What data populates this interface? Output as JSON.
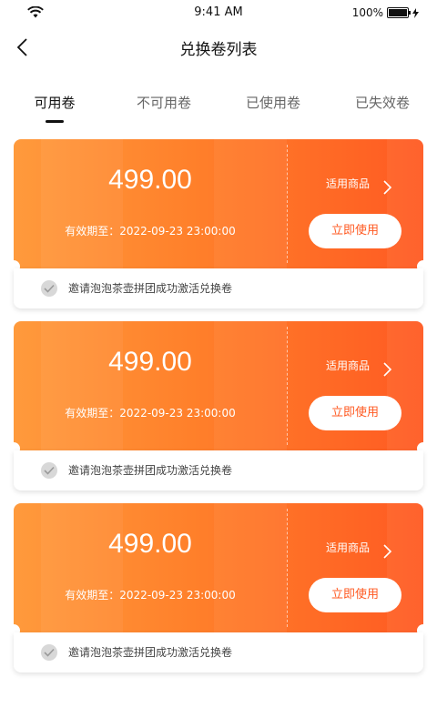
{
  "status_bar": {
    "time": "9:41 AM",
    "battery": "100%"
  },
  "nav": {
    "title": "兑换卷列表"
  },
  "tabs": [
    {
      "label": "可用卷"
    },
    {
      "label": "不可用卷"
    },
    {
      "label": "已使用卷"
    },
    {
      "label": "已失效卷"
    }
  ],
  "coupons": [
    {
      "amount": "499.00",
      "expiry_label": "有效期至：",
      "expiry_value": "2022-09-23 23:00:00",
      "applicable": "适用商品",
      "use_button": "立即使用",
      "invite_text": "邀请泡泡茶壶拼团成功激活兑换卷"
    },
    {
      "amount": "499.00",
      "expiry_label": "有效期至：",
      "expiry_value": "2022-09-23 23:00:00",
      "applicable": "适用商品",
      "use_button": "立即使用",
      "invite_text": "邀请泡泡茶壶拼团成功激活兑换卷"
    },
    {
      "amount": "499.00",
      "expiry_label": "有效期至：",
      "expiry_value": "2022-09-23 23:00:00",
      "applicable": "适用商品",
      "use_button": "立即使用",
      "invite_text": "邀请泡泡茶壶拼团成功激活兑换卷"
    }
  ],
  "colors": {
    "accent": "#ff5a22",
    "gradient_start": "#ff9a3c",
    "gradient_end": "#ff5a22"
  }
}
